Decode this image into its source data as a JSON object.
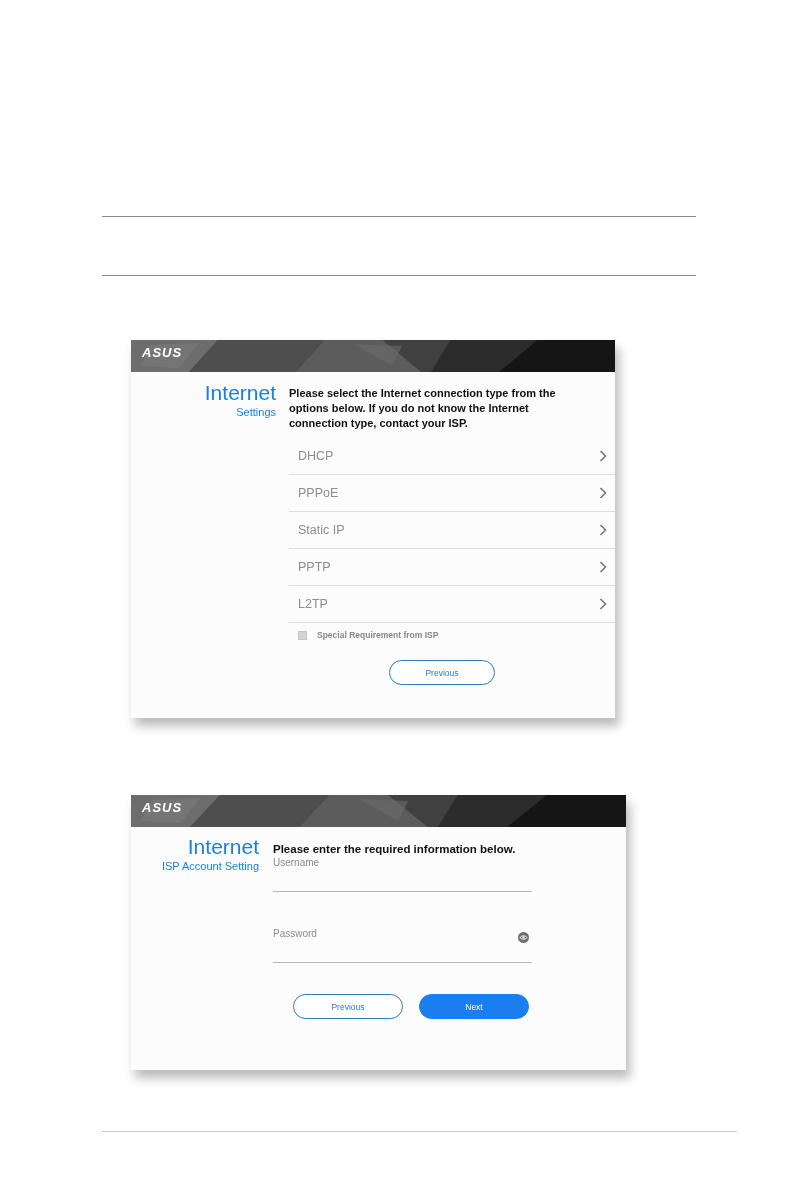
{
  "screens": [
    {
      "kind": "connection",
      "logo": "ASUS",
      "title": "Internet",
      "subtitle": "Settings",
      "instruction": "Please select the Internet connection type from the options below. If you do not know the Internet connection type, contact your ISP.",
      "options": [
        {
          "label": "DHCP"
        },
        {
          "label": "PPPoE"
        },
        {
          "label": "Static IP"
        },
        {
          "label": "PPTP"
        },
        {
          "label": "L2TP"
        }
      ],
      "checkbox": {
        "label": "Special Requirement from ISP",
        "checked": false
      },
      "buttons": [
        {
          "label": "Previous",
          "primary": false
        }
      ]
    },
    {
      "kind": "account",
      "logo": "ASUS",
      "title": "Internet",
      "subtitle": "ISP Account Setting",
      "instruction": "Please enter the required information below.",
      "fields": [
        {
          "placeholder": "Username",
          "kind": "text"
        },
        {
          "placeholder": "Password",
          "kind": "password"
        }
      ],
      "buttons": [
        {
          "label": "Previous",
          "primary": false
        },
        {
          "label": "Next",
          "primary": true
        }
      ]
    }
  ]
}
